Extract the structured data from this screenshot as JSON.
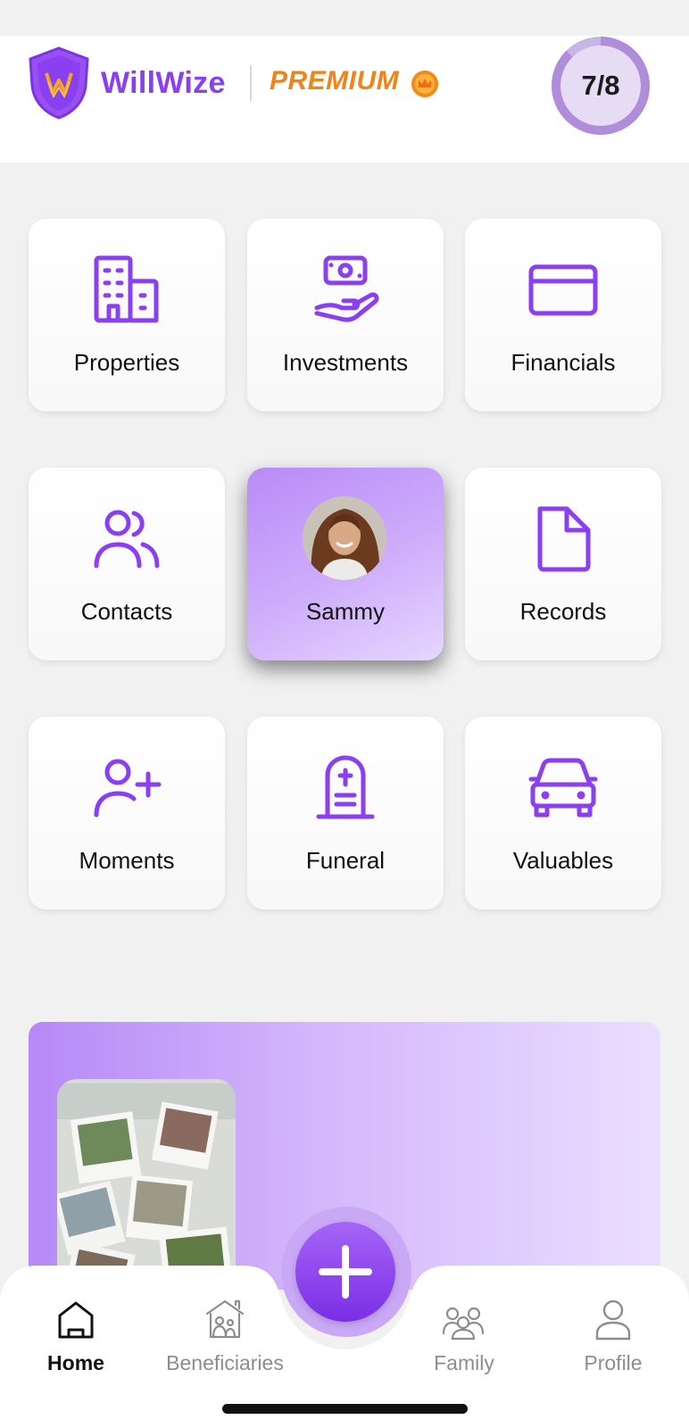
{
  "header": {
    "brand_name": "WillWize",
    "tier_label": "PREMIUM",
    "progress_label": "7/8",
    "progress": 0.875,
    "logo_icon": "shield-logo-icon",
    "tier_icon": "crown-icon"
  },
  "tiles": [
    {
      "label": "Properties",
      "icon": "buildings-icon"
    },
    {
      "label": "Investments",
      "icon": "money-hand-icon"
    },
    {
      "label": "Financials",
      "icon": "credit-card-icon"
    },
    {
      "label": "Contacts",
      "icon": "users-icon"
    },
    {
      "label": "Sammy",
      "icon": "avatar-photo"
    },
    {
      "label": "Records",
      "icon": "file-icon"
    },
    {
      "label": "Moments",
      "icon": "user-plus-icon"
    },
    {
      "label": "Funeral",
      "icon": "gravestone-icon"
    },
    {
      "label": "Valuables",
      "icon": "car-icon"
    }
  ],
  "nav": {
    "items": [
      {
        "label": "Home",
        "icon": "home-icon"
      },
      {
        "label": "Beneficiaries",
        "icon": "house-family-icon"
      },
      {
        "label": "Family",
        "icon": "family-icon"
      },
      {
        "label": "Profile",
        "icon": "user-icon"
      }
    ],
    "fab_icon": "plus-icon"
  },
  "colors": {
    "accent": "#8a3ff0",
    "premium": "#f08419",
    "progress_ring": "#b59ad9",
    "progress_fill": "#e6dcf4"
  }
}
